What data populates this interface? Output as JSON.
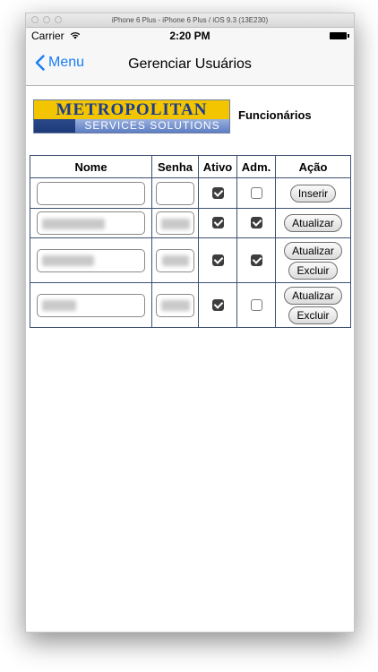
{
  "window": {
    "title": "iPhone 6 Plus - iPhone 6 Plus / iOS 9.3 (13E230)"
  },
  "status_bar": {
    "carrier": "Carrier",
    "time": "2:20 PM",
    "wifi_icon": "wifi-icon",
    "battery_icon": "battery-icon"
  },
  "nav": {
    "back_label": "Menu",
    "title": "Gerenciar Usuários"
  },
  "logo": {
    "line1": "METROPOLITAN",
    "line2": "SERVICES SOLUTIONS"
  },
  "section_label": "Funcionários",
  "table": {
    "headers": {
      "nome": "Nome",
      "senha": "Senha",
      "ativo": "Ativo",
      "adm": "Adm.",
      "acao": "Ação"
    },
    "new_row": {
      "nome": "",
      "senha": "",
      "ativo": true,
      "adm": false,
      "button": "Inserir"
    },
    "rows": [
      {
        "ativo": true,
        "adm": true,
        "buttons": [
          "Atualizar"
        ]
      },
      {
        "ativo": true,
        "adm": true,
        "buttons": [
          "Atualizar",
          "Excluir"
        ]
      },
      {
        "ativo": true,
        "adm": false,
        "buttons": [
          "Atualizar",
          "Excluir"
        ]
      }
    ]
  }
}
